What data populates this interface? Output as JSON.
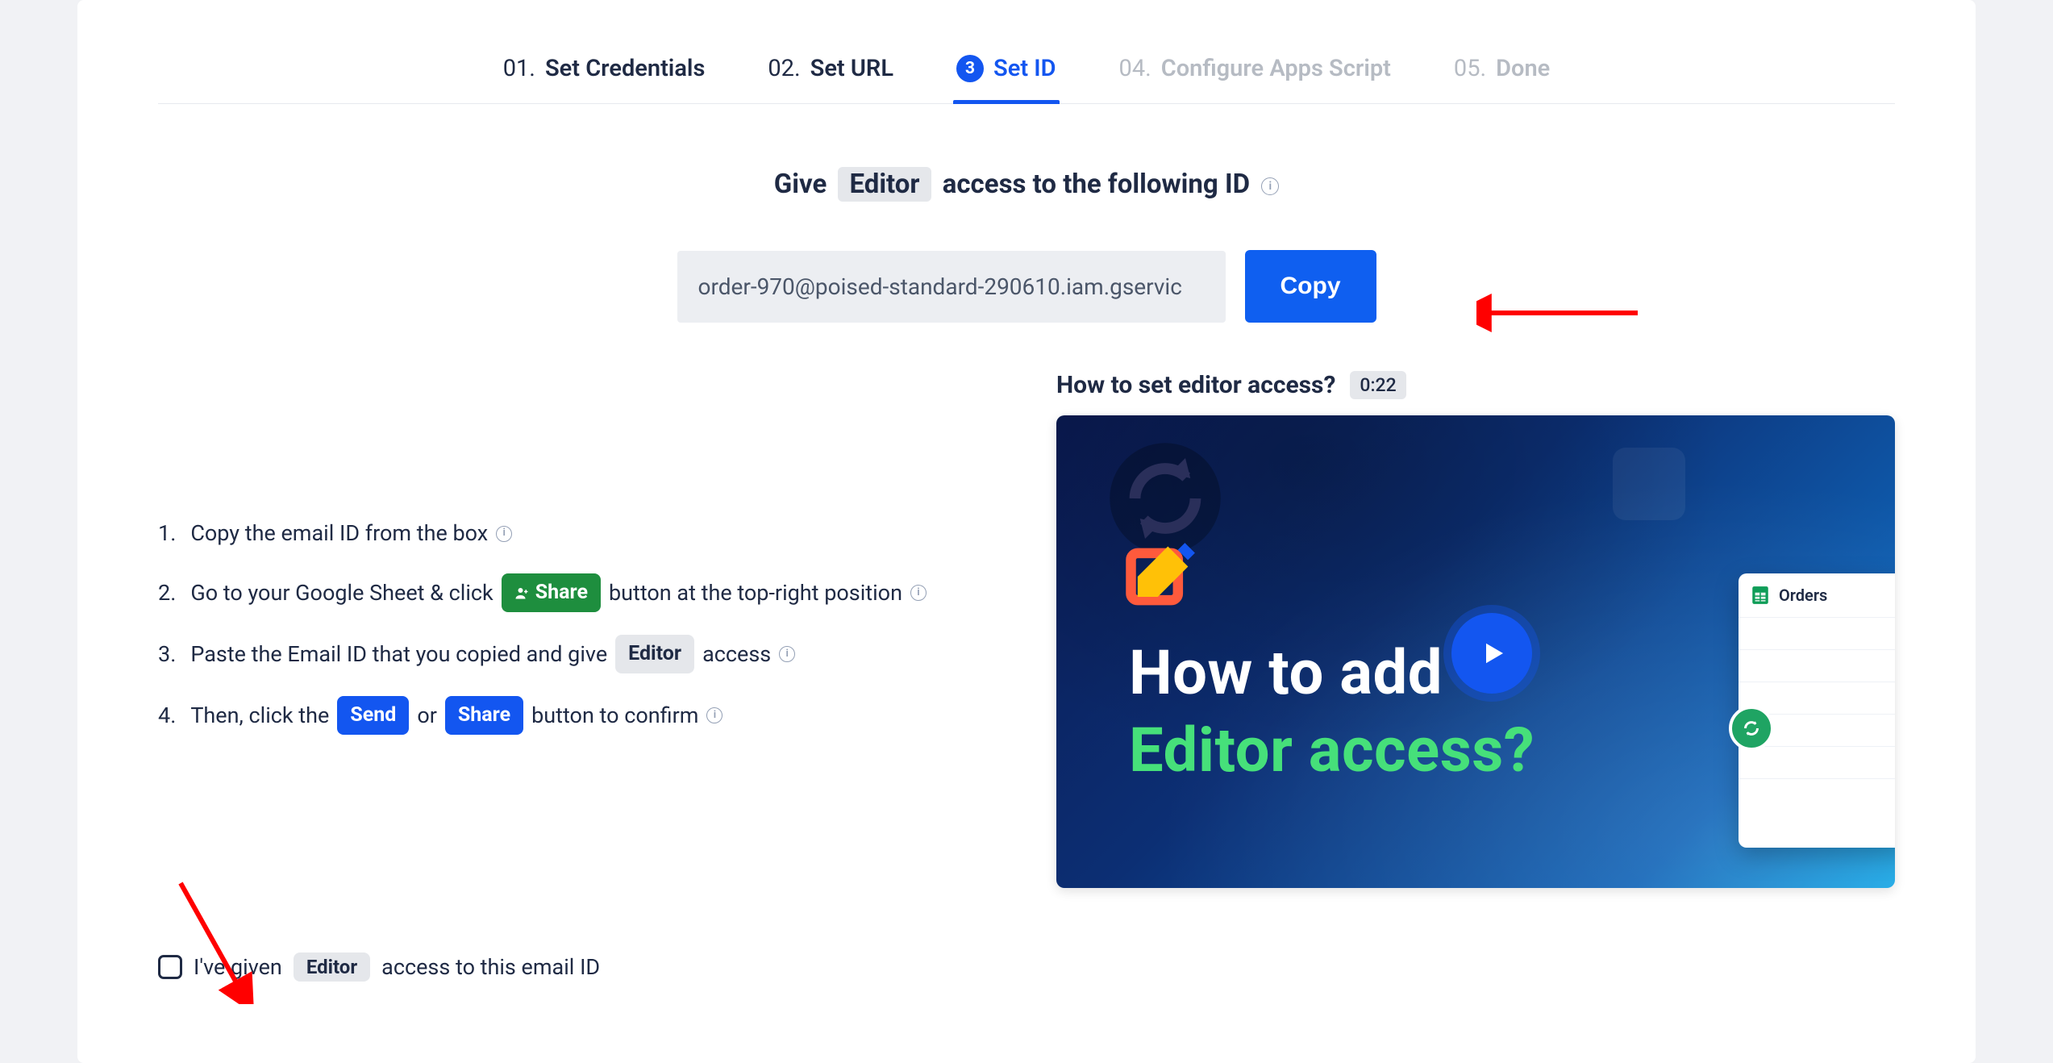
{
  "stepper": {
    "steps": [
      {
        "num": "01.",
        "label": "Set Credentials",
        "state": "done"
      },
      {
        "num": "02.",
        "label": "Set URL",
        "state": "done"
      },
      {
        "num": "3",
        "label": "Set ID",
        "state": "active"
      },
      {
        "num": "04.",
        "label": "Configure Apps Script",
        "state": "disabled"
      },
      {
        "num": "05.",
        "label": "Done",
        "state": "disabled"
      }
    ]
  },
  "heading": {
    "prefix": "Give",
    "chip": "Editor",
    "suffix": "access to the following ID"
  },
  "id_field": {
    "value": "order-970@poised-standard-290610.iam.gservic",
    "copy_label": "Copy"
  },
  "instructions": {
    "items": [
      {
        "text": "Copy the email ID from the box"
      },
      {
        "prefix": "Go to your Google Sheet & click",
        "share_chip": "Share",
        "suffix": "button at the top-right position"
      },
      {
        "prefix": "Paste the Email ID that you copied and give",
        "editor_chip": "Editor",
        "suffix": "access"
      },
      {
        "prefix": "Then, click the",
        "send_chip": "Send",
        "or": "or",
        "share_chip": "Share",
        "suffix": "button to confirm"
      }
    ]
  },
  "video": {
    "title": "How to set editor access?",
    "duration": "0:22",
    "overlay_line1": "How to add",
    "overlay_line2": "Editor access?",
    "sheet_name": "Orders"
  },
  "confirm": {
    "prefix": "I've given",
    "chip": "Editor",
    "suffix": "access to this email ID",
    "checked": false
  }
}
